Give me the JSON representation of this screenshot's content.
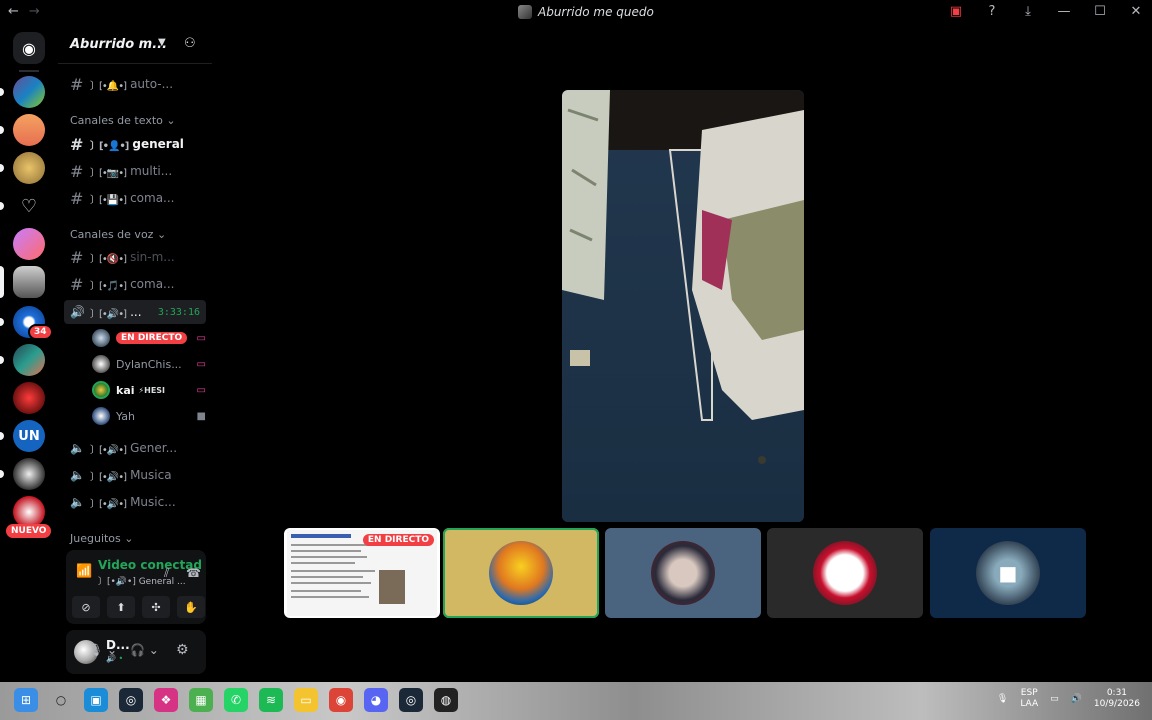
{
  "titlebar": {
    "back": "←",
    "forward": "→",
    "title": "Aburrido me quedo"
  },
  "rail": {
    "mention_badge": "34",
    "new_label": "NUEVO"
  },
  "sidebar": {
    "guild_name": "Aburrido m...",
    "categories": {
      "text": "Canales de texto",
      "voice": "Canales de voz",
      "games": "Jueguitos"
    },
    "channels": [
      {
        "name": "auto-...",
        "deco": "〕[•🔔•]"
      },
      {
        "name": "general",
        "deco": "〕[•👤•]"
      },
      {
        "name": "multi...",
        "deco": "〕[•📷•]"
      },
      {
        "name": "coma...",
        "deco": "〕[•💾•]"
      },
      {
        "name": "sin-m...",
        "deco": "〕[•🔇•]"
      },
      {
        "name": "coma...",
        "deco": "〕[•🎵•]"
      },
      {
        "name": "...",
        "deco": "〕[•🔊•]",
        "timer": "3:33:16"
      },
      {
        "name": "Gener...",
        "deco": "〕[•🔊•]"
      },
      {
        "name": "Musica",
        "deco": "〕[•🔊•]"
      },
      {
        "name": "Music...",
        "deco": "〕[•🔊•]"
      }
    ],
    "voice_users": [
      {
        "name": "",
        "live": "EN DIRECTO"
      },
      {
        "name": "DylanChis..."
      },
      {
        "name": "kai",
        "tag": "⚡HESI"
      },
      {
        "name": "Yah"
      }
    ]
  },
  "voice_panel": {
    "status": "Video conectad",
    "channel": "〕[•🔊•] General ..."
  },
  "user_panel": {
    "name": "D...",
    "sub": "🔊 •"
  },
  "stage": {
    "live_label": "EN DIRECTO"
  },
  "taskbar": {
    "lang_top": "ESP",
    "lang_bottom": "LAA",
    "time": "0:31",
    "date": "10/9/2026"
  },
  "colors": {
    "accent_green": "#23a559",
    "live_red": "#f23f43",
    "background": "#000000"
  }
}
